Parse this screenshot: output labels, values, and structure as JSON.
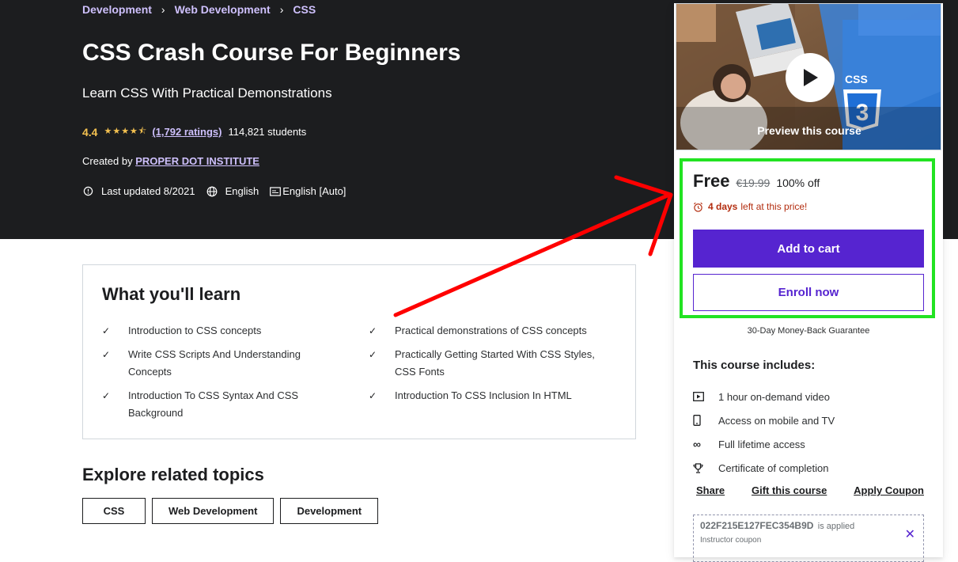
{
  "breadcrumb": [
    "Development",
    "Web Development",
    "CSS"
  ],
  "course": {
    "title": "CSS Crash Course For Beginners",
    "subtitle": "Learn CSS With Practical Demonstrations",
    "rating": "4.4",
    "rating_value": 4.4,
    "ratings_count": "(1,792 ratings)",
    "students": "114,821 students",
    "created_by_label": "Created by",
    "instructor": "PROPER DOT INSTITUTE",
    "last_updated": "Last updated 8/2021",
    "language": "English",
    "captions": "English [Auto]"
  },
  "learn": {
    "title": "What you'll learn",
    "items": [
      "Introduction to CSS concepts",
      "Practical demonstrations of CSS concepts",
      "Write CSS Scripts And Understanding Concepts",
      "Practically Getting Started With CSS Styles, CSS Fonts",
      "Introduction To CSS Syntax And CSS Background",
      "Introduction To CSS Inclusion In HTML"
    ]
  },
  "related": {
    "title": "Explore related topics",
    "topics": [
      "CSS",
      "Web Development",
      "Development"
    ]
  },
  "sidebar": {
    "preview_label": "Preview this course",
    "thumbnail_text": "CSS",
    "price_now": "Free",
    "price_old": "€19.99",
    "discount": "100% off",
    "deadline_bold": "4 days",
    "deadline_rest": "left at this price!",
    "add_to_cart": "Add to cart",
    "enroll_now": "Enroll now",
    "guarantee": "30-Day Money-Back Guarantee",
    "includes_title": "This course includes:",
    "includes": [
      {
        "icon": "video-icon",
        "text": "1 hour on-demand video"
      },
      {
        "icon": "mobile-icon",
        "text": "Access on mobile and TV"
      },
      {
        "icon": "infinity-icon",
        "text": "Full lifetime access"
      },
      {
        "icon": "trophy-icon",
        "text": "Certificate of completion"
      }
    ],
    "share": "Share",
    "gift": "Gift this course",
    "apply_coupon": "Apply Coupon",
    "coupon_code": "022F215E127FEC354B9D",
    "coupon_applied": "is applied",
    "coupon_sub": "Instructor coupon"
  },
  "colors": {
    "hero_bg": "#1c1d1f",
    "accent": "#5624d0",
    "link": "#cec0fc",
    "star": "#f4c150",
    "highlight": "#22e322",
    "annotation_arrow": "#ff0000"
  }
}
